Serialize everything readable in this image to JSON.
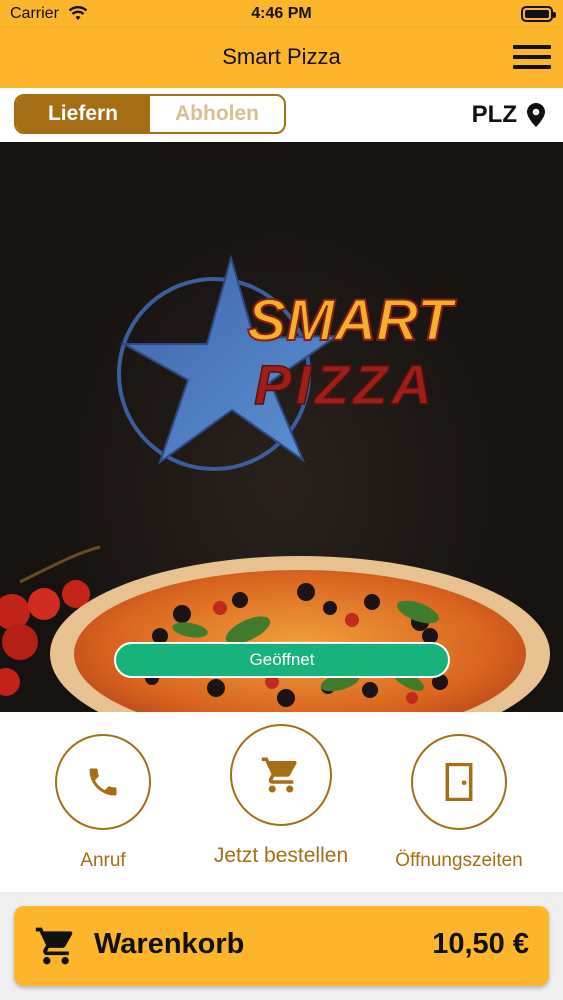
{
  "status_bar": {
    "carrier": "Carrier",
    "time": "4:46 PM"
  },
  "nav": {
    "title": "Smart Pizza",
    "menu_icon": "hamburger-menu-icon"
  },
  "mode_toggle": {
    "deliver": "Liefern",
    "pickup": "Abholen",
    "selected": "Liefern"
  },
  "location": {
    "label": "PLZ",
    "icon": "location-pin-icon"
  },
  "hero": {
    "logo_line1": "SMART",
    "logo_line2": "PIZZA",
    "status": "Geöffnet",
    "status_color": "#17b37c"
  },
  "actions": [
    {
      "label": "Anruf",
      "icon": "phone-icon"
    },
    {
      "label": "Jetzt bestellen",
      "icon": "cart-icon"
    },
    {
      "label": "Öffnungszeiten",
      "icon": "door-icon"
    }
  ],
  "cart": {
    "label": "Warenkorb",
    "total": "10,50 €",
    "icon": "cart-icon"
  },
  "colors": {
    "accent": "#fdb52b",
    "brown": "#a56e14",
    "open_green": "#17b37c"
  }
}
